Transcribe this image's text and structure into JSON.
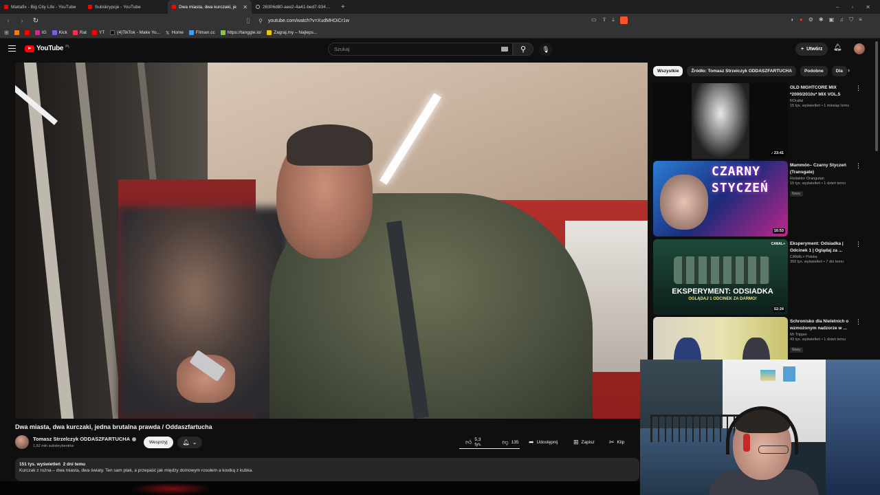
{
  "browser": {
    "tabs": [
      {
        "label": "Mattafix - Big City Life - YouTube",
        "favicon": "youtube",
        "active": false
      },
      {
        "label": "Subskrypcje - YouTube",
        "favicon": "youtube",
        "active": false
      },
      {
        "label": "Dwa miasta, dwa kurczaki, je",
        "favicon": "youtube",
        "active": true
      },
      {
        "label": "26306d80-aee2-4a41-bed7-934a8c",
        "favicon": "globe",
        "active": false
      }
    ],
    "url": "youtube.com/watch?v=XudMHDiCr1w",
    "bookmarks": [
      {
        "label": "IG",
        "color": "#d6249f"
      },
      {
        "label": "Kick",
        "color": "#7a5af5"
      },
      {
        "label": "Rat",
        "color": "#ff2d55"
      },
      {
        "label": "YT",
        "color": "#ff0000"
      },
      {
        "label": "(4)TikTok - Make Yo...",
        "color": "#111111"
      },
      {
        "label": "Home",
        "color": "#ffffff"
      },
      {
        "label": "Filman.cc",
        "color": "#3aa0ff"
      },
      {
        "label": "https://tanggle.io/",
        "color": "#8bc34a"
      },
      {
        "label": "Zagraj.my – Najleps...",
        "color": "#f1c40f"
      }
    ]
  },
  "youtube": {
    "logo": "YouTube",
    "logo_country": "PL",
    "search_placeholder": "Szukaj",
    "create_label": "Utwórz"
  },
  "video": {
    "title": "Dwa miasta, dwa kurczaki, jedna brutalna prawda / Oddaszfartucha",
    "channel": "Tomasz Strzelczyk ODDASZFARTUCHA",
    "subscribers": "1,62 mln subskrybentów",
    "support_label": "Wesprzyj",
    "likes": "5,3 tys.",
    "dislikes": "135",
    "share_label": "Udostępnij",
    "save_label": "Zapisz",
    "clip_label": "Klip",
    "views": "151 tys. wyświetleń",
    "posted": "2 dni temu",
    "description_line1": "Kurczak z rożna – dwa miasta, dwa światy. Ten sam ptak, a przepaść jak między domowym rosołem a kostką z kubka."
  },
  "sidebar": {
    "chips": [
      "Wszystkie",
      "Źródło: Tomasz Strzelczyk ODDASZFARTUCHA",
      "Podobne",
      "Dla"
    ],
    "recommendations": [
      {
        "title": "OLD NIGHTCORE MIX *2000/2010s* MIX VOL.5",
        "channel": "ROrafal",
        "meta": "15 tys. wyświetleń • 1 miesiąc temu",
        "duration": "♪ 23:41",
        "badge": ""
      },
      {
        "title": "Mammón– Czarny Styczeń (Transgate)",
        "channel": "Redaktor Orangutan",
        "meta": "15 tys. wyświetleń • 1 dzień temu",
        "duration": "16:53",
        "badge": "Nowy",
        "thumb_text": "CZARNY STYCZEŃ"
      },
      {
        "title": "Eksperyment: Odsiadka | Odcinek 1 | Oglądaj za ...",
        "channel": "CANAL+ Polska",
        "meta": "392 tys. wyświetleń • 7 dni temu",
        "duration": "52:24",
        "badge": "",
        "thumb_text": "EKSPERYMENT: ODSIADKA",
        "thumb_sub": "OGLĄDAJ 1 ODCINEK ZA DARMO!",
        "thumb_brand": "CANAL+"
      },
      {
        "title": "Schronisko dla Nieletnich o wzmożonym nadzorze w ...",
        "channel": "Mr Tripper",
        "meta": "43 tys. wyświetleń • 1 dzień temu",
        "duration": "",
        "badge": "Nowy"
      }
    ]
  }
}
